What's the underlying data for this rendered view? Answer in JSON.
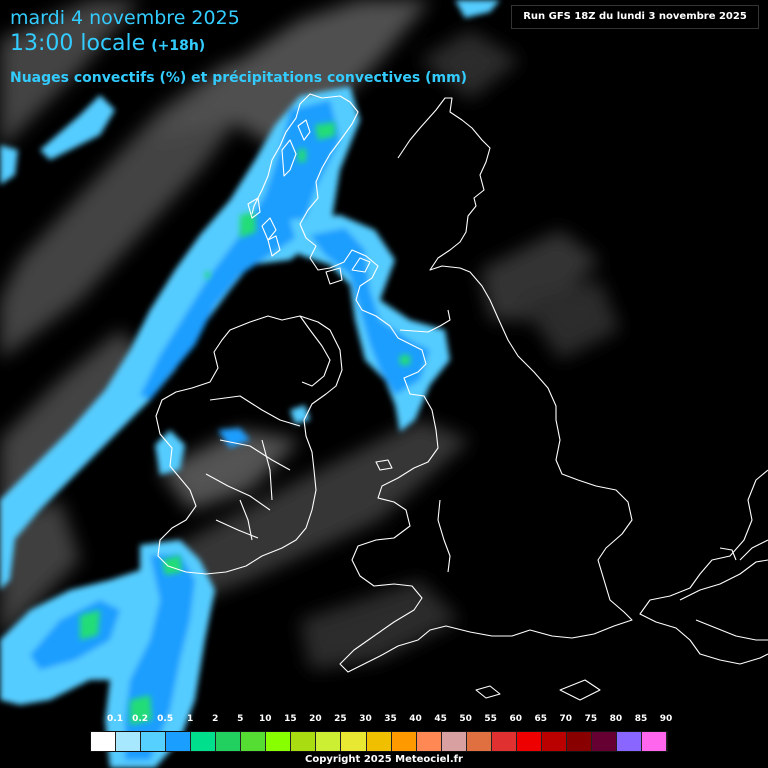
{
  "header": {
    "date": "mardi 4 novembre 2025",
    "time": "13:00 locale",
    "offset": "(+18h)",
    "title": "Nuages convectifs (%) et précipitations convectives (mm)"
  },
  "run_label": "Run GFS 18Z du lundi 3 novembre 2025",
  "legend": {
    "labels": [
      "0.1",
      "0.2",
      "0.5",
      "1",
      "2",
      "5",
      "10",
      "15",
      "20",
      "25",
      "30",
      "35",
      "40",
      "45",
      "50",
      "55",
      "60",
      "65",
      "70",
      "75",
      "80",
      "85",
      "90"
    ],
    "colors": [
      "#ffffff",
      "#a8e8ff",
      "#55d0ff",
      "#1a9eff",
      "#00e08c",
      "#22d060",
      "#55dd33",
      "#88ff00",
      "#aadd11",
      "#ccee33",
      "#e8e833",
      "#f0c000",
      "#ff9900",
      "#ff8855",
      "#d8a0a0",
      "#e07040",
      "#e03030",
      "#ee0000",
      "#bb0000",
      "#880000",
      "#660033",
      "#8866ff",
      "#ff66ee"
    ]
  },
  "copyright": "Copyright 2025 Meteociel.fr",
  "colors": {
    "header_text": "#33ccff",
    "precip_light": "#55ccff",
    "precip_mid": "#1a9eff",
    "precip_heavy": "#22dd77",
    "coastline": "#ffffff"
  }
}
